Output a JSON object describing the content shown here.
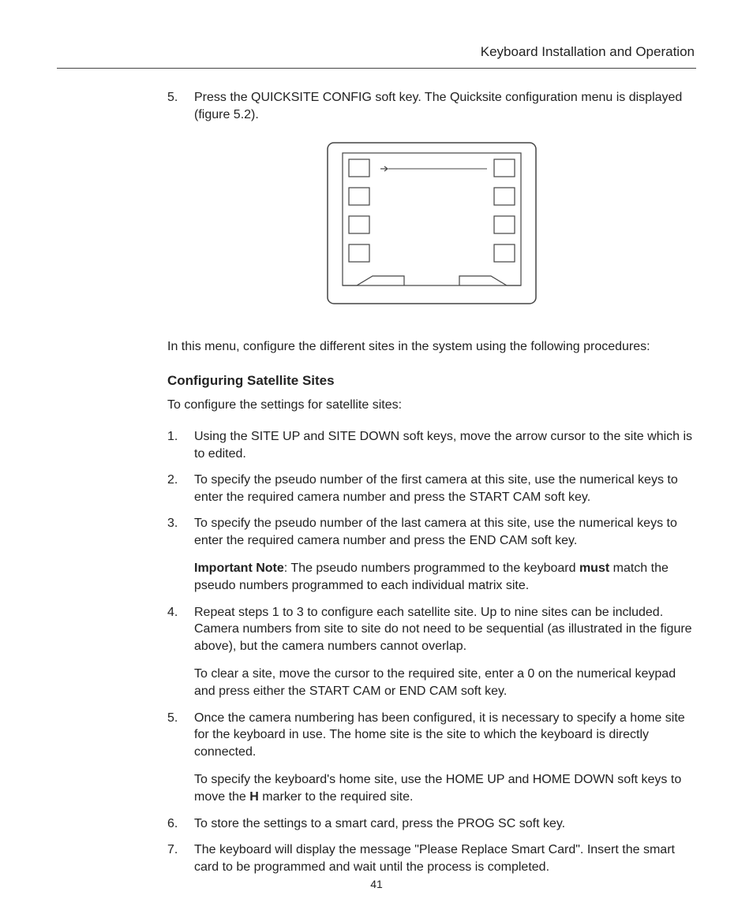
{
  "header": {
    "title": "Keyboard Installation and Operation"
  },
  "top_list": {
    "item5": {
      "num": "5.",
      "text": "Press the QUICKSITE CONFIG soft key. The Quicksite configuration menu is displayed (figure 5.2)."
    }
  },
  "lead_in": "In this menu, configure the different sites in the system using the following procedures:",
  "section": {
    "heading": "Configuring Satellite Sites",
    "intro": "To configure the settings for satellite sites:"
  },
  "steps": {
    "s1": {
      "num": "1.",
      "p1": "Using the SITE UP and SITE DOWN soft keys, move the arrow cursor to the site which is to edited."
    },
    "s2": {
      "num": "2.",
      "p1": "To specify the pseudo number of the first camera at this site, use the numerical keys to enter the required camera number and press the START CAM soft key."
    },
    "s3": {
      "num": "3.",
      "p1": "To specify the pseudo number of the last camera at this site, use the numerical keys to enter the required camera number and press the END CAM soft key.",
      "note_label": "Important Note",
      "note_sep": ": ",
      "note_a": "The pseudo numbers programmed to the keyboard ",
      "note_bold": "must",
      "note_b": " match the pseudo numbers programmed to each individual matrix site."
    },
    "s4": {
      "num": "4.",
      "p1": "Repeat steps 1 to 3 to configure each satellite site. Up to nine sites can be included. Camera numbers from site to site do not need to be sequential (as illustrated in the figure above), but the camera numbers cannot overlap.",
      "p2": "To clear a site, move the cursor to the required site, enter a 0 on the numerical keypad and press either the START CAM or END CAM soft key."
    },
    "s5": {
      "num": "5.",
      "p1": "Once the camera numbering has been configured, it is necessary to specify a home site for the keyboard in use. The home site is the site to which the keyboard is directly connected.",
      "p2a": "To specify the keyboard's home site, use the HOME UP and HOME DOWN soft keys to move the ",
      "p2bold": "H",
      "p2b": " marker to the required site."
    },
    "s6": {
      "num": "6.",
      "p1": "To store the settings to a smart card, press the PROG SC soft key."
    },
    "s7": {
      "num": "7.",
      "p1": "The keyboard will display the message \"Please Replace Smart Card\". Insert the smart card to be programmed and wait until the process is completed."
    }
  },
  "page_number": "41"
}
